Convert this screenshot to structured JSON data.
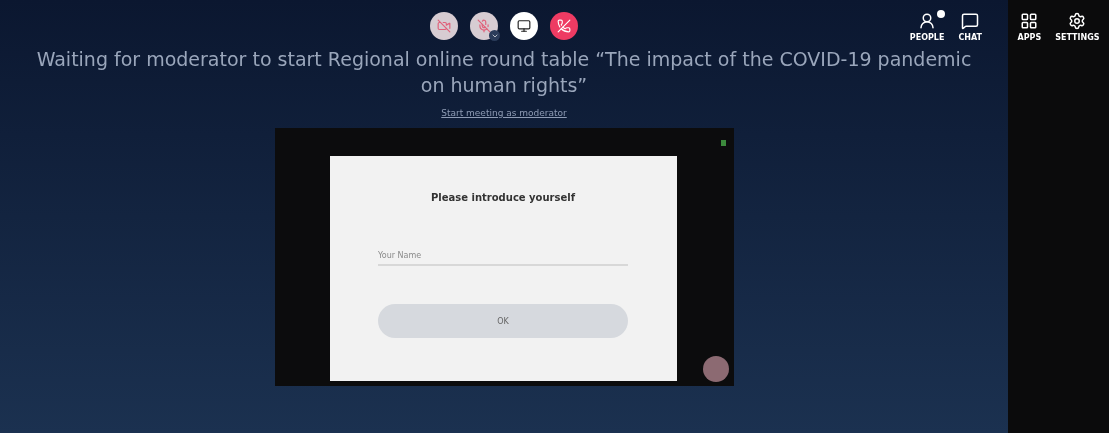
{
  "toolbar": [
    {
      "kind": "camera",
      "muted": true
    },
    {
      "kind": "microphone",
      "muted": true
    },
    {
      "kind": "screen",
      "muted": false
    },
    {
      "kind": "hangup",
      "muted": false
    }
  ],
  "side_buttons": [
    {
      "kind": "people",
      "label": "PEOPLE",
      "badge": true
    },
    {
      "kind": "chat",
      "label": "CHAT",
      "badge": false
    }
  ],
  "panel_buttons": [
    {
      "kind": "apps",
      "label": "APPS"
    },
    {
      "kind": "settings",
      "label": "SETTINGS"
    }
  ],
  "title": "Waiting for moderator to start Regional online round table “The impact of the COVID-19 pandemic on human rights”",
  "moderator_link": "Start meeting as moderator",
  "dialog": {
    "title": "Please introduce yourself",
    "name_field": {
      "placeholder": "Your Name"
    },
    "button": "OK"
  }
}
